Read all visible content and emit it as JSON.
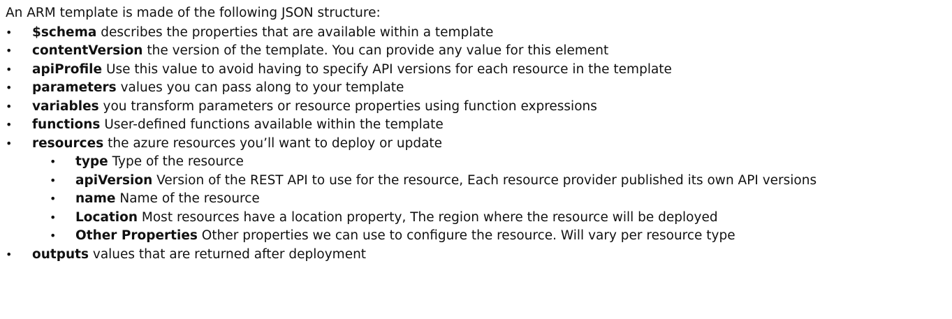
{
  "intro": "An ARM template is made of the following JSON structure:",
  "bullet_glyph": "•",
  "items": [
    {
      "term": "$schema",
      "desc": " describes the properties that are available within a template"
    },
    {
      "term": "contentVersion",
      "desc": " the version of the template.  You can provide any value for this element"
    },
    {
      "term": "apiProfile",
      "desc": " Use this value to avoid having to specify API versions for each resource in the template"
    },
    {
      "term": "parameters",
      "desc": " values you can pass along to your template"
    },
    {
      "term": "variables",
      "desc": " you transform parameters or resource properties using function expressions"
    },
    {
      "term": "functions",
      "desc": " User-defined functions available within the template"
    },
    {
      "term": "resources",
      "desc": " the azure resources you’ll want to deploy or update"
    }
  ],
  "sub_items": [
    {
      "term": "type",
      "desc": "  Type of the resource"
    },
    {
      "term": "apiVersion",
      "desc": "  Version of the REST API to use for the resource, Each resource provider published its own API versions"
    },
    {
      "term": "name",
      "desc": " Name of the resource"
    },
    {
      "term": "Location",
      "desc": " Most resources have a location property, The region where the resource will be deployed"
    },
    {
      "term": "Other Properties",
      "desc": " Other properties we can use to configure the resource. Will vary per resource type"
    }
  ],
  "last_item": {
    "term": "outputs",
    "desc": " values that are returned after deployment"
  }
}
